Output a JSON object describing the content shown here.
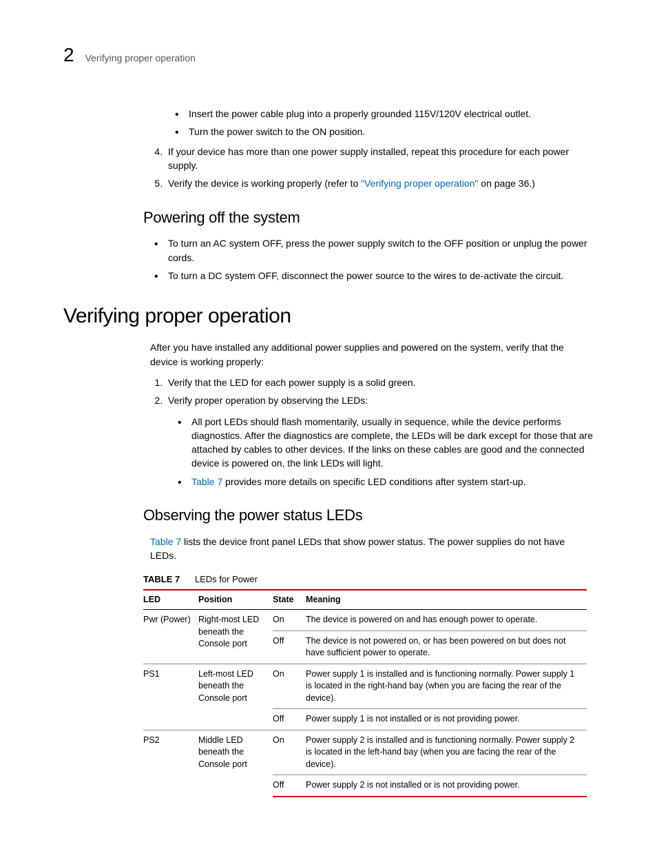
{
  "header": {
    "chapter_number": "2",
    "running_title": "Verifying proper operation"
  },
  "top_bullets": [
    "Insert the power cable plug into a properly grounded 115V/120V electrical outlet.",
    "Turn the power switch to the ON position."
  ],
  "top_numbered": {
    "item4": "If your device has more than one power supply installed, repeat this procedure for each power supply.",
    "item5_pre": "Verify the device is working properly (refer to ",
    "item5_link": "\"Verifying proper operation\"",
    "item5_post": " on page 36.)"
  },
  "powering_off": {
    "heading": "Powering off the system",
    "items": [
      "To turn an AC system OFF, press the power supply switch to the OFF position or unplug the power cords.",
      "To turn a DC system OFF, disconnect the power source to the wires to de-activate the circuit."
    ]
  },
  "verifying": {
    "heading": "Verifying proper operation",
    "intro": "After you have installed any additional power supplies and powered on the system, verify that the device is working properly:",
    "n1": "Verify that the LED for each power supply is a solid green.",
    "n2": "Verify proper operation by observing the LEDs:",
    "sub1": "All port LEDs should flash momentarily, usually in sequence, while the device performs diagnostics.  After the diagnostics are complete, the LEDs will be dark except for those that are attached by cables to other devices.  If the links on these cables are good and the connected device is powered on, the link LEDs will light.",
    "sub2_link": "Table 7",
    "sub2_post": " provides more details on specific LED conditions after system start-up."
  },
  "observing": {
    "heading": "Observing the power status LEDs",
    "intro_link": "Table 7",
    "intro_post": " lists the device front panel LEDs that show power status.  The power supplies do not have LEDs."
  },
  "table": {
    "label": "TABLE 7",
    "caption": "LEDs for Power",
    "headers": {
      "led": "LED",
      "position": "Position",
      "state": "State",
      "meaning": "Meaning"
    },
    "rows": [
      {
        "led": "Pwr (Power)",
        "position": "Right-most LED beneath the Console port",
        "state": "On",
        "meaning": "The device is powered on and has enough power to operate."
      },
      {
        "led": "",
        "position": "",
        "state": "Off",
        "meaning": "The device is not powered on, or has been powered on but does not have sufficient power to operate."
      },
      {
        "led": "PS1",
        "position": "Left-most LED beneath the Console port",
        "state": "On",
        "meaning": "Power supply 1 is installed and is functioning normally.  Power supply 1 is located in the right-hand bay (when you are facing the rear of the device)."
      },
      {
        "led": "",
        "position": "",
        "state": "Off",
        "meaning": "Power supply 1 is not installed or is not providing power."
      },
      {
        "led": "PS2",
        "position": "Middle LED beneath the Console port",
        "state": "On",
        "meaning": "Power supply 2 is installed and is functioning normally.  Power supply 2 is located in the left-hand bay (when you are facing the rear of the device)."
      },
      {
        "led": "",
        "position": "",
        "state": "Off",
        "meaning": "Power supply 2 is not installed or is not providing power."
      }
    ]
  }
}
